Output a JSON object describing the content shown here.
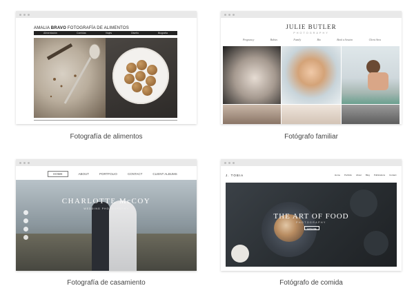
{
  "templates": [
    {
      "caption": "Fotografía de alimentos",
      "preview": {
        "header_name": "AMALIA",
        "header_bold": "BRAVO",
        "header_rest": "FOTOGRAFÍA DE ALIMENTOS",
        "menu": [
          "Alimentación",
          "Comidas",
          "Viajes",
          "Diseño",
          "Biografía"
        ]
      }
    },
    {
      "caption": "Fotógrafo familiar",
      "preview": {
        "title": "JULIE BUTLER",
        "subtitle": "PHOTOGRAPHY",
        "menu": [
          "Pregnancy",
          "Babies",
          "Family",
          "Bio",
          "Book a Session",
          "Client Area"
        ]
      }
    },
    {
      "caption": "Fotografía de casamiento",
      "preview": {
        "menu": [
          "HOME",
          "ABOUT",
          "PORTFOLIO",
          "CONTACT",
          "CLIENT ALBUMS"
        ],
        "title": "CHARLOTTE McCOY",
        "subtitle": "WEDDING PHOTOGRAPHY"
      }
    },
    {
      "caption": "Fotógrafo de comida",
      "preview": {
        "logo": "J. TOBIA",
        "menu": [
          "Home",
          "Portfolio",
          "About",
          "Blog",
          "Publications",
          "Contact"
        ],
        "title": "THE ART OF FOOD",
        "subtitle": "PHOTOGRAPHY",
        "button": "EXPLORE"
      }
    }
  ]
}
